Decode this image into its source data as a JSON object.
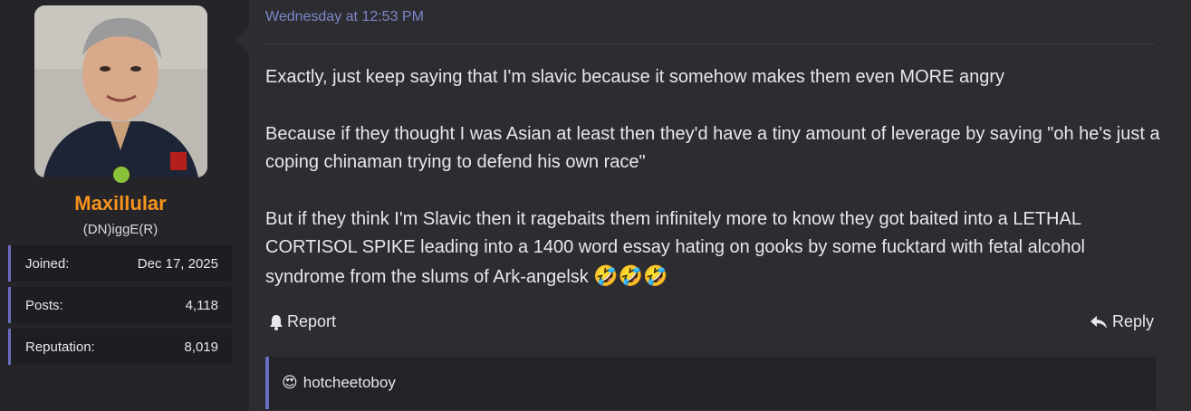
{
  "user": {
    "username": "Maxillular",
    "title": "(DN)iggE(R)",
    "status_color": "#8bc23b",
    "name_color": "#f7931e",
    "stats": [
      {
        "label": "Joined:",
        "value": "Dec 17, 2025"
      },
      {
        "label": "Posts:",
        "value": "4,118"
      },
      {
        "label": "Reputation:",
        "value": "8,019"
      }
    ]
  },
  "post": {
    "timestamp": "Wednesday at 12:53 PM",
    "paragraphs": [
      "Exactly, just keep saying that I'm slavic because it somehow makes them even MORE angry",
      "Because if they thought I was Asian at least then they'd have a tiny amount of leverage by saying \"oh he's just a coping chinaman trying to defend his own race\"",
      "But if they think I'm Slavic then it ragebaits them infinitely more to know they got baited into a LETHAL CORTISOL SPIKE leading into a 1400 word essay hating on gooks by some fucktard with fetal alcohol syndrome from the slums of Ark-angelsk"
    ],
    "trailing_emoji": "🤣🤣🤣",
    "actions": {
      "report": "Report",
      "reply": "Reply"
    },
    "reaction": {
      "emoji": "😍",
      "user": "hotcheetoboy"
    }
  },
  "icons": {
    "report": "bell-icon",
    "reply": "reply-arrow-icon"
  }
}
